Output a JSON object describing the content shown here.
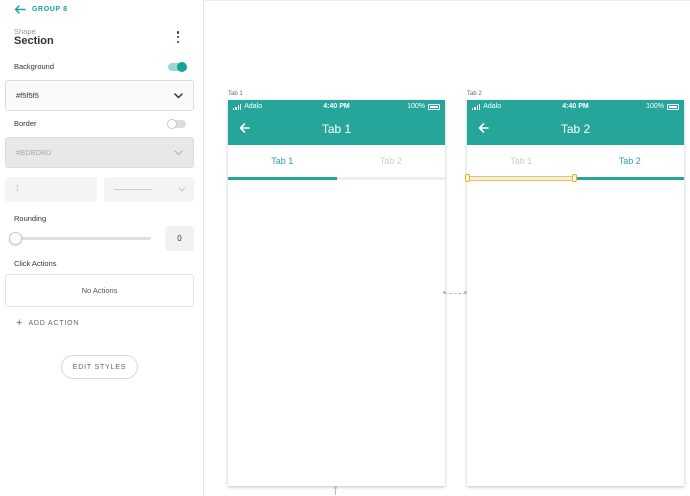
{
  "panel": {
    "back_label": "GROUP 8",
    "shape_caption": "Shape",
    "shape_name": "Section",
    "background_label": "Background",
    "background_toggle": true,
    "background_value": "#f5f5f5",
    "border_label": "Border",
    "border_toggle": false,
    "border_value": "#BDBDBD",
    "border_width_placeholder": "1",
    "rounding_label": "Rounding",
    "rounding_value": "0",
    "rounding_slider_fraction": 0,
    "click_actions_label": "Click Actions",
    "no_actions_text": "No Actions",
    "add_action_label": "ADD ACTION",
    "edit_styles_label": "EDIT STYLES"
  },
  "colors": {
    "accent": "#16a19a",
    "app_bar": "#26a69a",
    "selection": "#f4c542"
  },
  "screens": [
    {
      "label": "Tab 1",
      "status_carrier": "Adalo",
      "status_time": "4:40 PM",
      "status_battery": "100%",
      "title": "Tab 1",
      "tabs": [
        {
          "label": "Tab 1",
          "active": true
        },
        {
          "label": "Tab 2",
          "active": false
        }
      ],
      "active_index": 0
    },
    {
      "label": "Tab 2",
      "status_carrier": "Adalo",
      "status_time": "4:40 PM",
      "status_battery": "100%",
      "title": "Tab 2",
      "tabs": [
        {
          "label": "Tab 1",
          "active": false
        },
        {
          "label": "Tab 2",
          "active": true
        }
      ],
      "active_index": 1
    }
  ],
  "icons": {
    "back": "arrow-left-icon",
    "menu": "kebab-menu-icon",
    "dropdown": "chevron-down-icon",
    "add": "plus-icon",
    "signal": "signal-icon",
    "battery": "battery-icon"
  }
}
